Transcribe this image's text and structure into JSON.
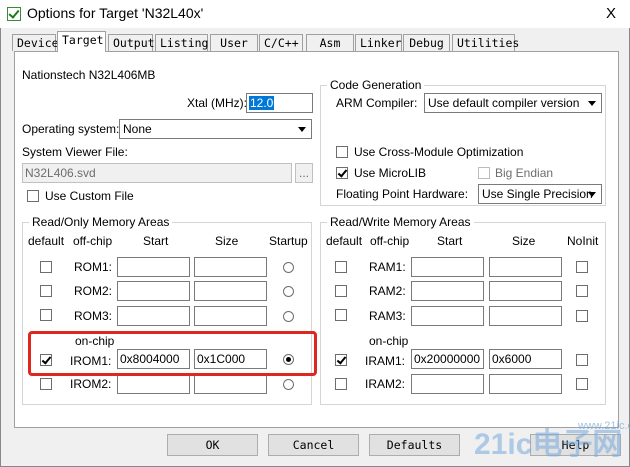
{
  "window": {
    "title": "Options for Target 'N32L40x'",
    "close_glyph": "X"
  },
  "tabs": [
    {
      "label": "Device",
      "active": false
    },
    {
      "label": "Target",
      "active": true
    },
    {
      "label": "Output",
      "active": false
    },
    {
      "label": "Listing",
      "active": false
    },
    {
      "label": "User",
      "active": false
    },
    {
      "label": "C/C++",
      "active": false
    },
    {
      "label": "Asm",
      "active": false
    },
    {
      "label": "Linker",
      "active": false
    },
    {
      "label": "Debug",
      "active": false
    },
    {
      "label": "Utilities",
      "active": false
    }
  ],
  "target": {
    "device_name": "Nationstech N32L406MB",
    "xtal_label": "Xtal (MHz):",
    "xtal_value": "12.0",
    "os_label": "Operating system:",
    "os_value": "None",
    "svd_label": "System Viewer File:",
    "svd_value": "N32L406.svd",
    "browse_label": "...",
    "custom_file_label": "Use Custom File",
    "custom_file_checked": false
  },
  "code_generation": {
    "title": "Code Generation",
    "compiler_label": "ARM Compiler:",
    "compiler_value": "Use default compiler version",
    "cross_module_label": "Use Cross-Module Optimization",
    "cross_module_checked": false,
    "microlib_label": "Use MicroLIB",
    "microlib_checked": true,
    "big_endian_label": "Big Endian",
    "big_endian_checked": false,
    "fp_label": "Floating Point Hardware:",
    "fp_value": "Use Single Precision"
  },
  "ro_memory": {
    "title": "Read/Only Memory Areas",
    "headers": {
      "default": "default",
      "offchip": "off-chip",
      "start": "Start",
      "size": "Size",
      "startup": "Startup"
    },
    "onchip_label": "on-chip",
    "rows": [
      {
        "name": "ROM1:",
        "start": "",
        "size": "",
        "default": false,
        "startup": false
      },
      {
        "name": "ROM2:",
        "start": "",
        "size": "",
        "default": false,
        "startup": false
      },
      {
        "name": "ROM3:",
        "start": "",
        "size": "",
        "default": false,
        "startup": false
      },
      {
        "name": "IROM1:",
        "start": "0x8004000",
        "size": "0x1C000",
        "default": true,
        "startup": true
      },
      {
        "name": "IROM2:",
        "start": "",
        "size": "",
        "default": false,
        "startup": false
      }
    ]
  },
  "rw_memory": {
    "title": "Read/Write Memory Areas",
    "headers": {
      "default": "default",
      "offchip": "off-chip",
      "start": "Start",
      "size": "Size",
      "noinit": "NoInit"
    },
    "onchip_label": "on-chip",
    "rows": [
      {
        "name": "RAM1:",
        "start": "",
        "size": "",
        "default": false,
        "noinit": false
      },
      {
        "name": "RAM2:",
        "start": "",
        "size": "",
        "default": false,
        "noinit": false
      },
      {
        "name": "RAM3:",
        "start": "",
        "size": "",
        "default": false,
        "noinit": false
      },
      {
        "name": "IRAM1:",
        "start": "0x20000000",
        "size": "0x6000",
        "default": true,
        "noinit": false
      },
      {
        "name": "IRAM2:",
        "start": "",
        "size": "",
        "default": false,
        "noinit": false
      }
    ]
  },
  "buttons": {
    "ok": "OK",
    "cancel": "Cancel",
    "defaults": "Defaults",
    "help": "Help"
  },
  "watermark": {
    "text": "21ic电子网",
    "site": "www.21ic.com"
  },
  "accent": {
    "highlight": "#e0271f",
    "xtal_selection": "#0078d7"
  }
}
